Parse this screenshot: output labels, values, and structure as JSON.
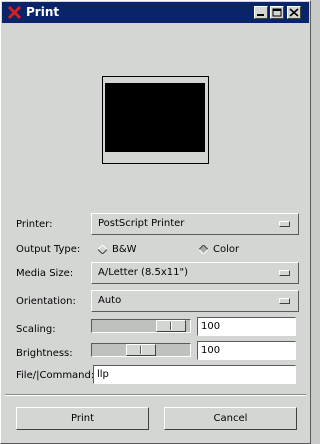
{
  "window": {
    "title": "Print"
  },
  "colors": {
    "titlebar": "#0a246a",
    "close_icon": "#d42020"
  },
  "icons": {
    "app": "x-close-icon",
    "minimize": "minimize-icon",
    "maximize": "maximize-icon",
    "close": "close-icon"
  },
  "form": {
    "printer": {
      "label": "Printer:",
      "value": "PostScript Printer"
    },
    "output_type": {
      "label": "Output Type:",
      "options": [
        "B&W",
        "Color"
      ],
      "selected": "Color"
    },
    "media_size": {
      "label": "Media Size:",
      "value": "A/Letter (8.5x11\")"
    },
    "orientation": {
      "label": "Orientation:",
      "value": "Auto"
    },
    "scaling": {
      "label": "Scaling:",
      "value": "100",
      "slider_fraction": 0.94
    },
    "brightness": {
      "label": "Brightness:",
      "value": "100",
      "slider_fraction": 0.5
    },
    "file_command": {
      "label": "File/|Command:",
      "value": "llp"
    }
  },
  "buttons": {
    "print": "Print",
    "cancel": "Cancel"
  }
}
